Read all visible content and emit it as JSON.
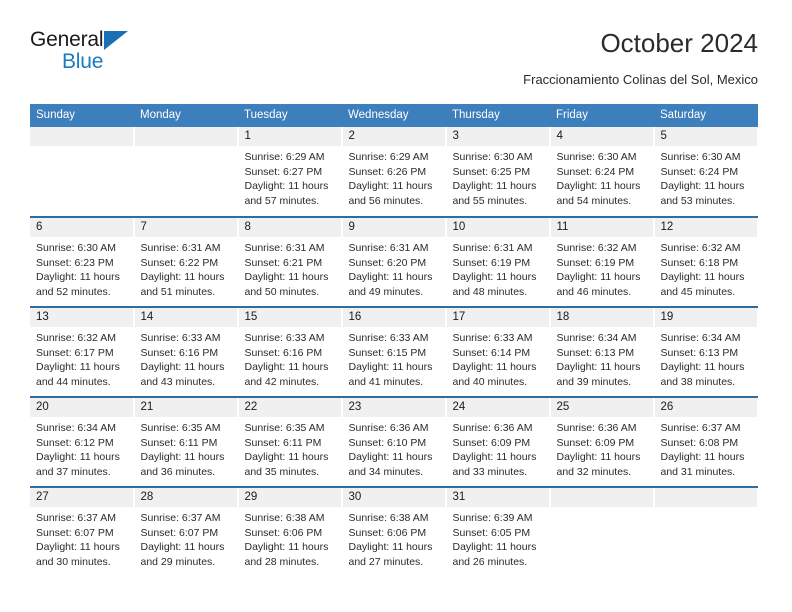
{
  "brand": {
    "name_top": "General",
    "name_bottom": "Blue",
    "accent_color": "#1a7ac4",
    "triangle_color": "#1a6fb5"
  },
  "header": {
    "title": "October 2024",
    "subtitle": "Fraccionamiento Colinas del Sol, Mexico"
  },
  "theme": {
    "header_row_bg": "#3d7ebc",
    "row_separator": "#2e6da4",
    "daynum_bg": "#f0f0f0",
    "text": "#2b2b2b"
  },
  "weekday_headers": [
    "Sunday",
    "Monday",
    "Tuesday",
    "Wednesday",
    "Thursday",
    "Friday",
    "Saturday"
  ],
  "weeks": [
    [
      {
        "day": "",
        "sunrise": "",
        "sunset": "",
        "daylight": "",
        "empty": true
      },
      {
        "day": "",
        "sunrise": "",
        "sunset": "",
        "daylight": "",
        "empty": true
      },
      {
        "day": "1",
        "sunrise": "Sunrise: 6:29 AM",
        "sunset": "Sunset: 6:27 PM",
        "daylight": "Daylight: 11 hours and 57 minutes."
      },
      {
        "day": "2",
        "sunrise": "Sunrise: 6:29 AM",
        "sunset": "Sunset: 6:26 PM",
        "daylight": "Daylight: 11 hours and 56 minutes."
      },
      {
        "day": "3",
        "sunrise": "Sunrise: 6:30 AM",
        "sunset": "Sunset: 6:25 PM",
        "daylight": "Daylight: 11 hours and 55 minutes."
      },
      {
        "day": "4",
        "sunrise": "Sunrise: 6:30 AM",
        "sunset": "Sunset: 6:24 PM",
        "daylight": "Daylight: 11 hours and 54 minutes."
      },
      {
        "day": "5",
        "sunrise": "Sunrise: 6:30 AM",
        "sunset": "Sunset: 6:24 PM",
        "daylight": "Daylight: 11 hours and 53 minutes."
      }
    ],
    [
      {
        "day": "6",
        "sunrise": "Sunrise: 6:30 AM",
        "sunset": "Sunset: 6:23 PM",
        "daylight": "Daylight: 11 hours and 52 minutes."
      },
      {
        "day": "7",
        "sunrise": "Sunrise: 6:31 AM",
        "sunset": "Sunset: 6:22 PM",
        "daylight": "Daylight: 11 hours and 51 minutes."
      },
      {
        "day": "8",
        "sunrise": "Sunrise: 6:31 AM",
        "sunset": "Sunset: 6:21 PM",
        "daylight": "Daylight: 11 hours and 50 minutes."
      },
      {
        "day": "9",
        "sunrise": "Sunrise: 6:31 AM",
        "sunset": "Sunset: 6:20 PM",
        "daylight": "Daylight: 11 hours and 49 minutes."
      },
      {
        "day": "10",
        "sunrise": "Sunrise: 6:31 AM",
        "sunset": "Sunset: 6:19 PM",
        "daylight": "Daylight: 11 hours and 48 minutes."
      },
      {
        "day": "11",
        "sunrise": "Sunrise: 6:32 AM",
        "sunset": "Sunset: 6:19 PM",
        "daylight": "Daylight: 11 hours and 46 minutes."
      },
      {
        "day": "12",
        "sunrise": "Sunrise: 6:32 AM",
        "sunset": "Sunset: 6:18 PM",
        "daylight": "Daylight: 11 hours and 45 minutes."
      }
    ],
    [
      {
        "day": "13",
        "sunrise": "Sunrise: 6:32 AM",
        "sunset": "Sunset: 6:17 PM",
        "daylight": "Daylight: 11 hours and 44 minutes."
      },
      {
        "day": "14",
        "sunrise": "Sunrise: 6:33 AM",
        "sunset": "Sunset: 6:16 PM",
        "daylight": "Daylight: 11 hours and 43 minutes."
      },
      {
        "day": "15",
        "sunrise": "Sunrise: 6:33 AM",
        "sunset": "Sunset: 6:16 PM",
        "daylight": "Daylight: 11 hours and 42 minutes."
      },
      {
        "day": "16",
        "sunrise": "Sunrise: 6:33 AM",
        "sunset": "Sunset: 6:15 PM",
        "daylight": "Daylight: 11 hours and 41 minutes."
      },
      {
        "day": "17",
        "sunrise": "Sunrise: 6:33 AM",
        "sunset": "Sunset: 6:14 PM",
        "daylight": "Daylight: 11 hours and 40 minutes."
      },
      {
        "day": "18",
        "sunrise": "Sunrise: 6:34 AM",
        "sunset": "Sunset: 6:13 PM",
        "daylight": "Daylight: 11 hours and 39 minutes."
      },
      {
        "day": "19",
        "sunrise": "Sunrise: 6:34 AM",
        "sunset": "Sunset: 6:13 PM",
        "daylight": "Daylight: 11 hours and 38 minutes."
      }
    ],
    [
      {
        "day": "20",
        "sunrise": "Sunrise: 6:34 AM",
        "sunset": "Sunset: 6:12 PM",
        "daylight": "Daylight: 11 hours and 37 minutes."
      },
      {
        "day": "21",
        "sunrise": "Sunrise: 6:35 AM",
        "sunset": "Sunset: 6:11 PM",
        "daylight": "Daylight: 11 hours and 36 minutes."
      },
      {
        "day": "22",
        "sunrise": "Sunrise: 6:35 AM",
        "sunset": "Sunset: 6:11 PM",
        "daylight": "Daylight: 11 hours and 35 minutes."
      },
      {
        "day": "23",
        "sunrise": "Sunrise: 6:36 AM",
        "sunset": "Sunset: 6:10 PM",
        "daylight": "Daylight: 11 hours and 34 minutes."
      },
      {
        "day": "24",
        "sunrise": "Sunrise: 6:36 AM",
        "sunset": "Sunset: 6:09 PM",
        "daylight": "Daylight: 11 hours and 33 minutes."
      },
      {
        "day": "25",
        "sunrise": "Sunrise: 6:36 AM",
        "sunset": "Sunset: 6:09 PM",
        "daylight": "Daylight: 11 hours and 32 minutes."
      },
      {
        "day": "26",
        "sunrise": "Sunrise: 6:37 AM",
        "sunset": "Sunset: 6:08 PM",
        "daylight": "Daylight: 11 hours and 31 minutes."
      }
    ],
    [
      {
        "day": "27",
        "sunrise": "Sunrise: 6:37 AM",
        "sunset": "Sunset: 6:07 PM",
        "daylight": "Daylight: 11 hours and 30 minutes."
      },
      {
        "day": "28",
        "sunrise": "Sunrise: 6:37 AM",
        "sunset": "Sunset: 6:07 PM",
        "daylight": "Daylight: 11 hours and 29 minutes."
      },
      {
        "day": "29",
        "sunrise": "Sunrise: 6:38 AM",
        "sunset": "Sunset: 6:06 PM",
        "daylight": "Daylight: 11 hours and 28 minutes."
      },
      {
        "day": "30",
        "sunrise": "Sunrise: 6:38 AM",
        "sunset": "Sunset: 6:06 PM",
        "daylight": "Daylight: 11 hours and 27 minutes."
      },
      {
        "day": "31",
        "sunrise": "Sunrise: 6:39 AM",
        "sunset": "Sunset: 6:05 PM",
        "daylight": "Daylight: 11 hours and 26 minutes."
      },
      {
        "day": "",
        "sunrise": "",
        "sunset": "",
        "daylight": "",
        "empty": true
      },
      {
        "day": "",
        "sunrise": "",
        "sunset": "",
        "daylight": "",
        "empty": true
      }
    ]
  ]
}
